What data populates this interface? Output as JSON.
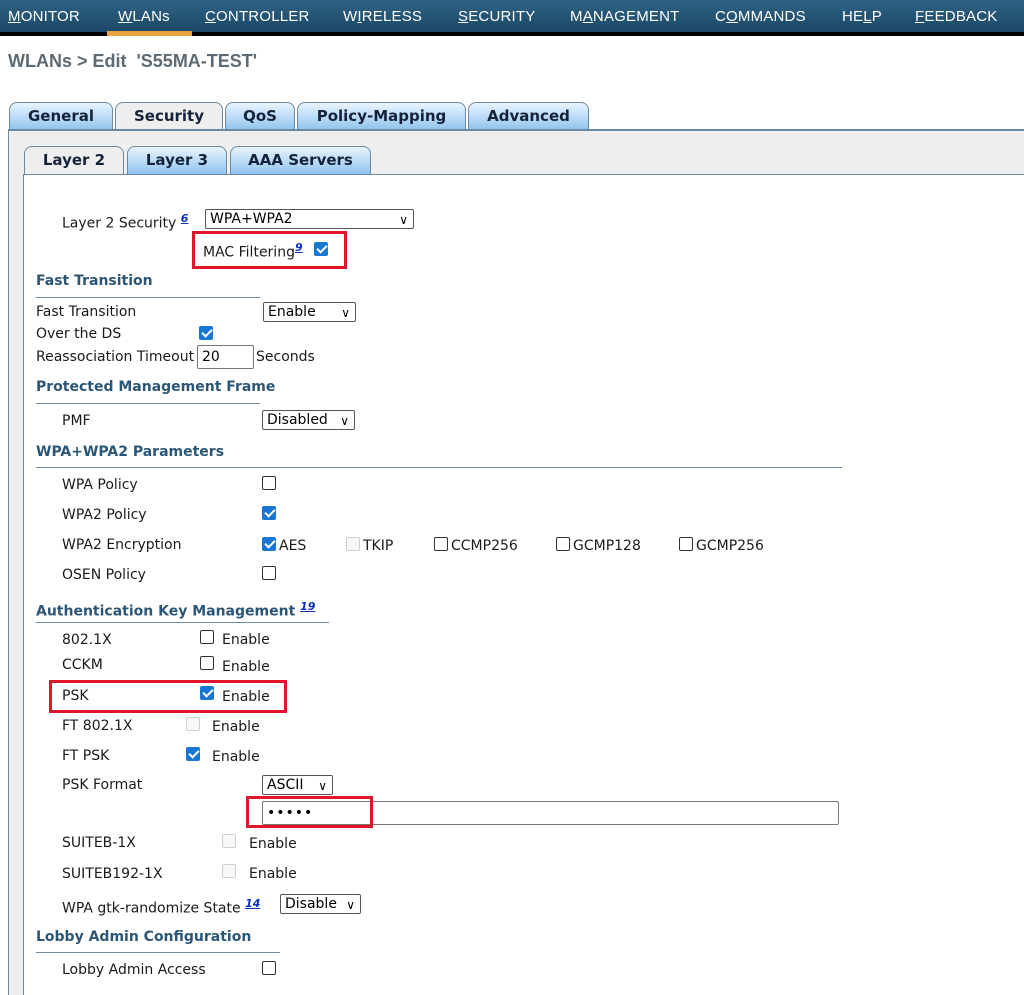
{
  "nav": [
    {
      "pre": "",
      "u": "M",
      "post": "ONITOR"
    },
    {
      "pre": "",
      "u": "W",
      "post": "LANs"
    },
    {
      "pre": "",
      "u": "C",
      "post": "ONTROLLER"
    },
    {
      "pre": "W",
      "u": "I",
      "post": "RELESS"
    },
    {
      "pre": "",
      "u": "S",
      "post": "ECURITY"
    },
    {
      "pre": "M",
      "u": "A",
      "post": "NAGEMENT"
    },
    {
      "pre": "C",
      "u": "O",
      "post": "MMANDS"
    },
    {
      "pre": "HE",
      "u": "L",
      "post": "P"
    },
    {
      "pre": "",
      "u": "F",
      "post": "EEDBACK"
    }
  ],
  "breadcrumb": "WLANs > Edit  'S55MA-TEST'",
  "tabs_main": [
    "General",
    "Security",
    "QoS",
    "Policy-Mapping",
    "Advanced"
  ],
  "tabs_sub": [
    "Layer 2",
    "Layer 3",
    "AAA Servers"
  ],
  "layer2": {
    "label": "Layer 2 Security",
    "ref": "6",
    "value": "WPA+WPA2",
    "mac_label": "MAC Filtering",
    "mac_ref": "9"
  },
  "ft": {
    "title": "Fast Transition",
    "ft_label": "Fast Transition",
    "ft_value": "Enable",
    "over_ds": "Over the DS",
    "reassoc": "Reassociation Timeout",
    "reassoc_value": "20",
    "reassoc_unit": "Seconds"
  },
  "pmf": {
    "title": "Protected Management Frame",
    "label": "PMF",
    "value": "Disabled"
  },
  "wpa": {
    "title": "WPA+WPA2 Parameters",
    "wpa_policy": "WPA Policy",
    "wpa2_policy": "WPA2 Policy",
    "wpa2_enc": "WPA2 Encryption",
    "aes": "AES",
    "tkip": "TKIP",
    "ccmp256": "CCMP256",
    "gcmp128": "GCMP128",
    "gcmp256": "GCMP256",
    "osen": "OSEN Policy"
  },
  "akm": {
    "title": "Authentication Key Management",
    "ref": "19",
    "enable": "Enable",
    "dot1x": "802.1X",
    "cckm": "CCKM",
    "psk": "PSK",
    "ft8021x": "FT 802.1X",
    "ftpsk": "FT PSK",
    "psk_format": "PSK Format",
    "psk_format_value": "ASCII",
    "psk_value": "•••••",
    "suiteb": "SUITEB-1X",
    "suiteb192": "SUITEB192-1X",
    "gtk": "WPA gtk-randomize State",
    "gtk_ref": "14",
    "gtk_value": "Disable"
  },
  "lobby": {
    "title": "Lobby Admin Configuration",
    "label": "Lobby Admin Access"
  }
}
